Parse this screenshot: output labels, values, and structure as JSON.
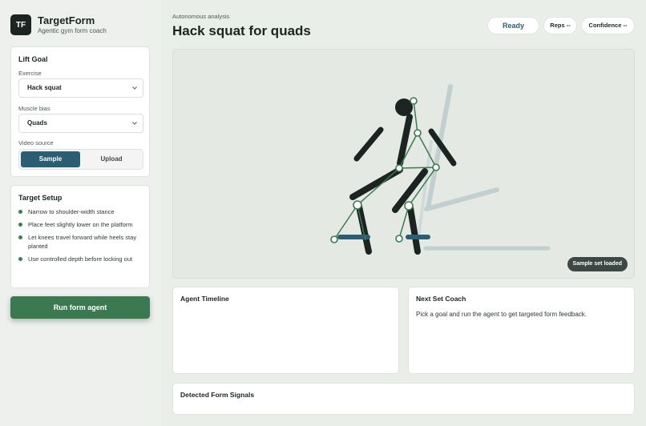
{
  "brand": {
    "logo": "TF",
    "name": "TargetForm",
    "tagline": "Agentic gym form coach"
  },
  "lift_goal": {
    "title": "Lift Goal",
    "exercise_label": "Exercise",
    "exercise_value": "Hack squat",
    "muscle_label": "Muscle bias",
    "muscle_value": "Quads",
    "source_label": "Video source",
    "source_options": [
      "Sample",
      "Upload"
    ],
    "source_selected": "Sample"
  },
  "target_setup": {
    "title": "Target Setup",
    "items": [
      "Narrow to shoulder-width stance",
      "Place feet slightly lower on the platform",
      "Let knees travel forward while heels stay planted",
      "Use controlled depth before locking out"
    ]
  },
  "run_button": "Run form agent",
  "header": {
    "eyebrow": "Autonomous analysis",
    "title": "Hack squat for quads"
  },
  "status": {
    "ready": "Ready",
    "reps": "Reps --",
    "confidence": "Confidence --"
  },
  "viewer": {
    "badge": "Sample set loaded"
  },
  "timeline": {
    "title": "Agent Timeline"
  },
  "coach": {
    "title": "Next Set Coach",
    "body": "Pick a goal and run the agent to get targeted form feedback."
  },
  "signals": {
    "title": "Detected Form Signals"
  },
  "colors": {
    "accent_blue": "#2c5e73",
    "accent_green": "#3b7a51",
    "dark": "#1b2421"
  },
  "icons": {
    "select_chevron": "chevron-down-icon",
    "bullet": "bullet-dot-icon"
  }
}
